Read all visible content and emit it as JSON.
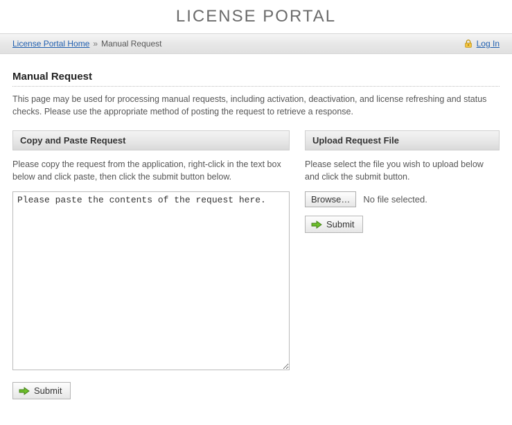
{
  "header": {
    "title": "LICENSE PORTAL"
  },
  "breadcrumb": {
    "home": "License Portal Home",
    "sep": "»",
    "current": "Manual Request"
  },
  "login": {
    "label": "Log In"
  },
  "page": {
    "title": "Manual Request",
    "description": "This page may be used for processing manual requests, including activation, deactivation, and license refreshing and status checks. Please use the appropriate method of posting the request to retrieve a response."
  },
  "copyPaste": {
    "heading": "Copy and Paste Request",
    "description": "Please copy the request from the application, right-click in the text box below and click paste, then click the submit button below.",
    "textareaValue": "Please paste the contents of the request here.",
    "submitLabel": "Submit"
  },
  "upload": {
    "heading": "Upload Request File",
    "description": "Please select the file you wish to upload below and click the submit button.",
    "browseLabel": "Browse…",
    "fileStatus": "No file selected.",
    "submitLabel": "Submit"
  }
}
